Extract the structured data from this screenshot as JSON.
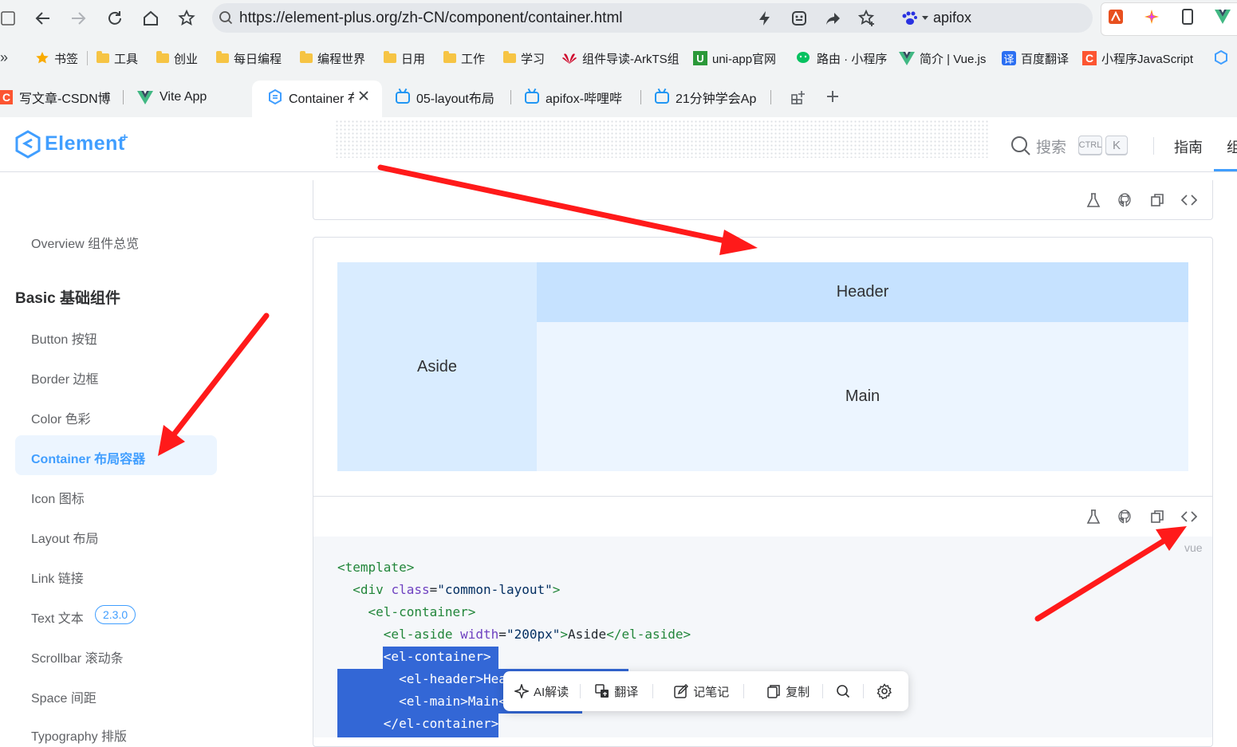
{
  "browser": {
    "url": "https://element-plus.org/zh-CN/component/container.html",
    "profile_label": "apifox",
    "bookmarks": [
      {
        "label": "书签",
        "icon": "star-icon"
      },
      {
        "label": "工具",
        "icon": "folder-icon"
      },
      {
        "label": "创业",
        "icon": "folder-icon"
      },
      {
        "label": "每日编程",
        "icon": "folder-icon"
      },
      {
        "label": "编程世界",
        "icon": "folder-icon"
      },
      {
        "label": "日用",
        "icon": "folder-icon"
      },
      {
        "label": "工作",
        "icon": "folder-icon"
      },
      {
        "label": "学习",
        "icon": "folder-icon"
      },
      {
        "label": "组件导读-ArkTS组",
        "icon": "huawei-icon"
      },
      {
        "label": "uni-app官网",
        "icon": "uniapp-icon"
      },
      {
        "label": "路由 · 小程序",
        "icon": "wechat-icon"
      },
      {
        "label": "简介 | Vue.js",
        "icon": "vue-icon"
      },
      {
        "label": "百度翻译",
        "icon": "translate-icon"
      },
      {
        "label": "小程序JavaScript",
        "icon": "csdn-icon"
      }
    ],
    "tabs": [
      {
        "label": "写文章-CSDN博"
      },
      {
        "label": "Vite App"
      },
      {
        "label": "Container 布"
      },
      {
        "label": "05-layout布局"
      },
      {
        "label": "apifox-哔哩哔"
      },
      {
        "label": "21分钟学会Ap"
      }
    ]
  },
  "site": {
    "logo_text": "Element",
    "logo_plus": "+",
    "search_label": "搜索",
    "kbd_ctrl": "CTRL",
    "kbd_k": "K",
    "nav_guide": "指南",
    "nav_component": "组件"
  },
  "sidebar": {
    "overview": "Overview 组件总览",
    "group_title": "Basic 基础组件",
    "items": [
      {
        "label": "Button 按钮"
      },
      {
        "label": "Border 边框"
      },
      {
        "label": "Color 色彩"
      },
      {
        "label": "Container 布局容器"
      },
      {
        "label": "Icon 图标"
      },
      {
        "label": "Layout 布局"
      },
      {
        "label": "Link 链接"
      },
      {
        "label": "Text 文本"
      },
      {
        "label": "Scrollbar 滚动条"
      },
      {
        "label": "Space 间距"
      },
      {
        "label": "Typography 排版"
      }
    ],
    "text_badge": "2.3.0"
  },
  "demo": {
    "aside": "Aside",
    "header": "Header",
    "main": "Main",
    "code_lang": "vue"
  },
  "code": {
    "l1_tag": "<template>",
    "l2_open": "<div ",
    "l2_attr": "class",
    "l2_eq": "=",
    "l2_val": "\"common-layout\"",
    "l2_close": ">",
    "l3": "<el-container>",
    "l4_open": "<el-aside ",
    "l4_attr": "width",
    "l4_eq": "=",
    "l4_val": "\"200px\"",
    "l4_gt": ">",
    "l4_text": "Aside",
    "l4_end": "</el-aside>",
    "l5": "<el-container>",
    "l6": "<el-header>Hea",
    "l7": "<el-main>Main<",
    "l8": "</el-container>"
  },
  "popup": {
    "ai": "AI解读",
    "translate": "翻译",
    "note": "记笔记",
    "copy": "复制"
  },
  "colors": {
    "brand": "#409eff",
    "aside_bg": "#d9ecff",
    "header_bg": "#c6e2ff",
    "main_bg": "#ecf5ff",
    "selection": "#3367d6",
    "annotation_arrow": "#ff1a1a"
  }
}
